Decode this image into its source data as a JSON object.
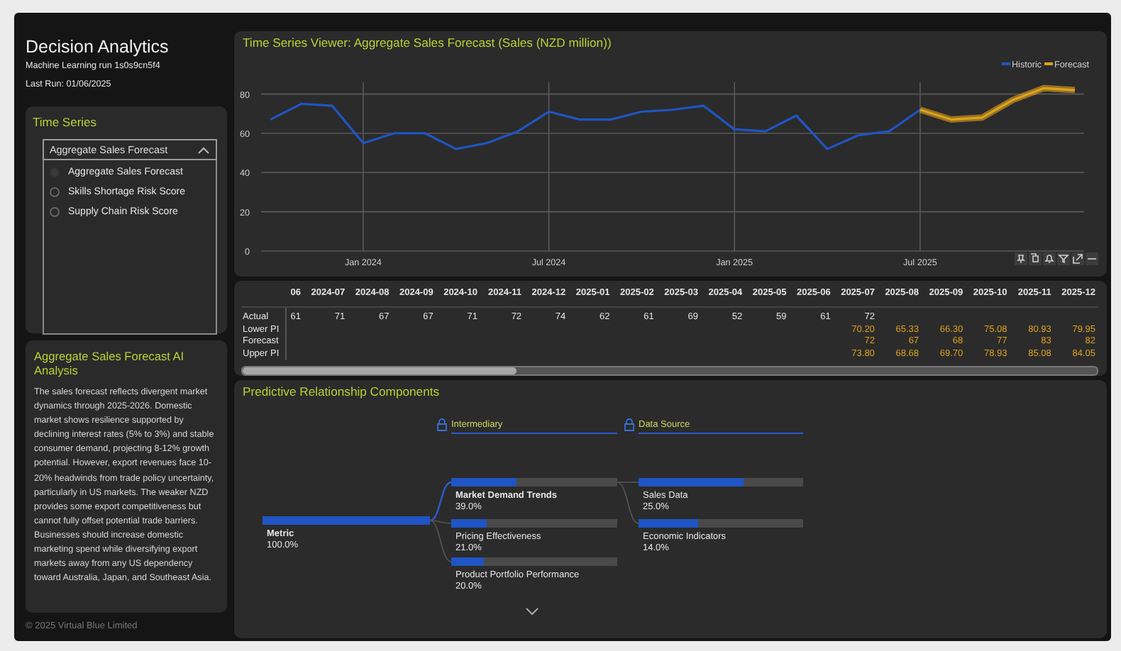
{
  "sidebar": {
    "title": "Decision Analytics",
    "run_label": "Machine Learning run 1s0s9cn5f4",
    "last_run": "Last Run: 01/06/2025",
    "series_selector": {
      "title": "Time Series",
      "value": "Aggregate Sales Forecast",
      "expanded": true,
      "options": [
        {
          "label": "Aggregate Sales Forecast",
          "selected": true
        },
        {
          "label": "Skills Shortage Risk Score",
          "selected": false
        },
        {
          "label": "Supply Chain Risk Score",
          "selected": false
        }
      ]
    },
    "analysis": {
      "title": "Aggregate Sales Forecast AI Analysis",
      "text": "The sales forecast reflects divergent market dynamics through 2025-2026. Domestic market shows resilience supported by declining interest rates (5% to 3%) and stable consumer demand, projecting 8-12% growth potential. However, export revenues face 10-20% headwinds from trade policy uncertainty, particularly in US markets. The weaker NZD provides some export competitiveness but cannot fully offset potential trade barriers. Businesses should increase domestic marketing spend while diversifying export markets away from any US dependency toward Australia, Japan, and Southeast Asia."
    },
    "footer": "© 2025 Virtual Blue Limited"
  },
  "chart_panel": {
    "title": "Time Series Viewer: Aggregate Sales Forecast (Sales (NZD million))",
    "chart_data": {
      "type": "line",
      "categories": [
        null,
        null,
        null,
        "Jan 2024",
        null,
        null,
        null,
        null,
        null,
        "Jul 2024",
        null,
        null,
        null,
        null,
        null,
        "Jan 2025",
        null,
        null,
        null,
        null,
        null,
        "Jul 2025",
        null,
        null,
        null,
        null,
        null
      ],
      "grid": true,
      "legend": "top-right",
      "ylim": [
        0,
        86
      ],
      "yticks": [
        0,
        20,
        40,
        60,
        80
      ],
      "series": [
        {
          "name": "Historic",
          "color": "#1f55c4",
          "values": [
            67,
            75,
            74,
            55,
            60,
            60,
            52,
            55,
            61,
            71,
            67,
            67,
            71,
            72,
            74,
            62,
            61,
            69,
            52,
            59,
            61,
            72,
            null,
            null,
            null,
            null,
            null
          ]
        },
        {
          "name": "Forecast",
          "color": "#e0a21c",
          "values": [
            null,
            null,
            null,
            null,
            null,
            null,
            null,
            null,
            null,
            null,
            null,
            null,
            null,
            null,
            null,
            null,
            null,
            null,
            null,
            null,
            null,
            72,
            67,
            68,
            77,
            83,
            82
          ]
        }
      ]
    }
  },
  "forecast_table": {
    "columns": [
      "06",
      "2024-07",
      "2024-08",
      "2024-09",
      "2024-10",
      "2024-11",
      "2024-12",
      "2025-01",
      "2025-02",
      "2025-03",
      "2025-04",
      "2025-05",
      "2025-06",
      "2025-07",
      "2025-08",
      "2025-09",
      "2025-10",
      "2025-11",
      "2025-12"
    ],
    "rows": [
      {
        "label": "Actual",
        "kind": "actual",
        "cells": [
          "61",
          "71",
          "67",
          "67",
          "71",
          "72",
          "74",
          "62",
          "61",
          "69",
          "52",
          "59",
          "61",
          "72",
          null,
          null,
          null,
          null,
          null
        ]
      },
      {
        "label": "Lower PI",
        "kind": "predicted",
        "cells": [
          null,
          null,
          null,
          null,
          null,
          null,
          null,
          null,
          null,
          null,
          null,
          null,
          null,
          "70.20",
          "65.33",
          "66.30",
          "75.08",
          "80.93",
          "79.95"
        ]
      },
      {
        "label": "Forecast",
        "kind": "predicted",
        "cells": [
          null,
          null,
          null,
          null,
          null,
          null,
          null,
          null,
          null,
          null,
          null,
          null,
          null,
          "72",
          "67",
          "68",
          "77",
          "83",
          "82"
        ]
      },
      {
        "label": "Upper PI",
        "kind": "predicted",
        "cells": [
          null,
          null,
          null,
          null,
          null,
          null,
          null,
          null,
          null,
          null,
          null,
          null,
          null,
          "73.80",
          "68.68",
          "69.70",
          "78.93",
          "85.08",
          "84.05"
        ]
      }
    ]
  },
  "decomposition": {
    "title": "Predictive Relationship Components",
    "levels": [
      {
        "title": "Intermediary",
        "locked": true
      },
      {
        "title": "Data Source",
        "locked": true
      }
    ],
    "root": {
      "label": "Metric",
      "value": "100.0%",
      "level": 1,
      "children": [
        {
          "label": "Market Demand Trends",
          "value": "39.0%",
          "level": 0.39,
          "selected": true,
          "children": [
            {
              "label": "Sales Data",
              "value": "25.0%",
              "level": 0.64
            },
            {
              "label": "Economic Indicators",
              "value": "14.0%",
              "level": 0.36
            }
          ]
        },
        {
          "label": "Pricing Effectiveness",
          "value": "21.0%",
          "level": 0.21,
          "selected": false
        },
        {
          "label": "Product Portfolio Performance",
          "value": "20.0%",
          "level": 0.2,
          "selected": false
        }
      ]
    }
  }
}
